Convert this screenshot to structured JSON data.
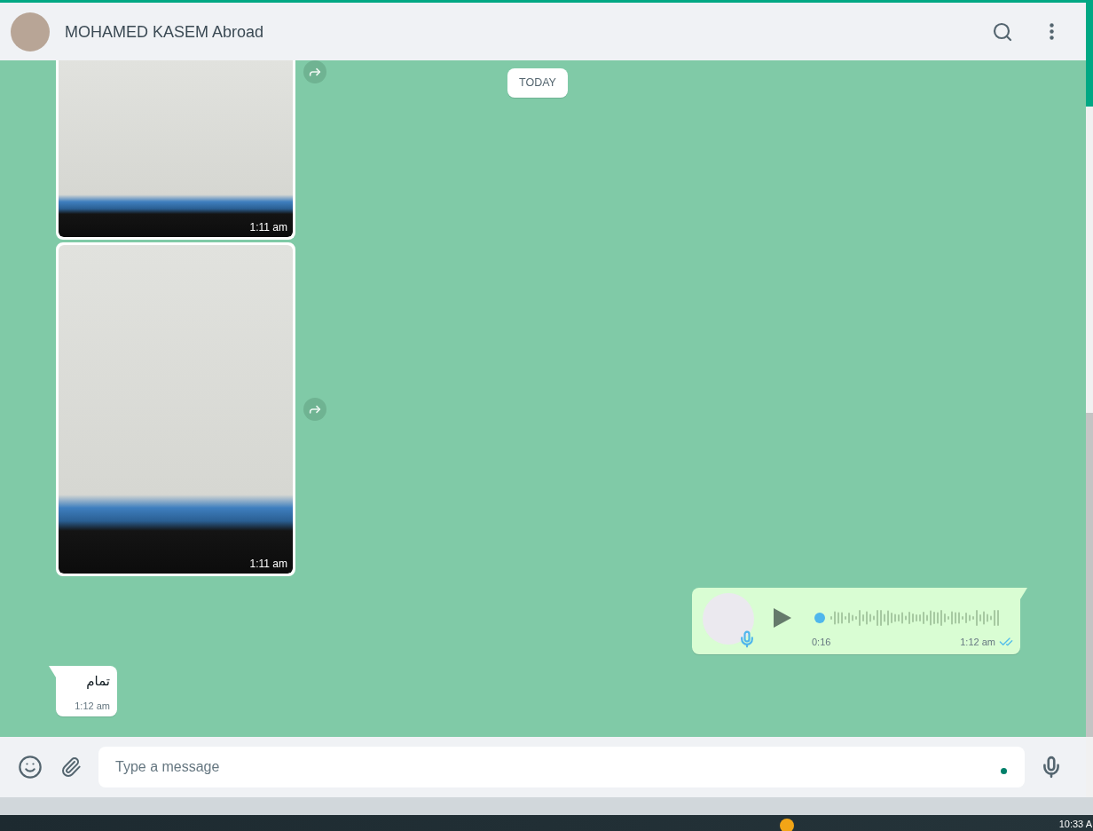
{
  "header": {
    "contact_name": "MOHAMED KASEM Abroad"
  },
  "date_chip": "TODAY",
  "messages": [
    {
      "kind": "image",
      "outgoing": false,
      "time": "1:11 am",
      "forward": true,
      "clipped": true
    },
    {
      "kind": "image",
      "outgoing": false,
      "time": "1:11 am",
      "forward": true,
      "clipped": false
    },
    {
      "kind": "voice",
      "outgoing": true,
      "duration": "0:16",
      "time": "1:12 am",
      "read": true,
      "level": 0
    },
    {
      "kind": "text",
      "outgoing": false,
      "text": "تمام",
      "time": "1:12 am"
    }
  ],
  "composer": {
    "placeholder": "Type a message"
  },
  "taskbar": {
    "clock": "10:33 A"
  }
}
